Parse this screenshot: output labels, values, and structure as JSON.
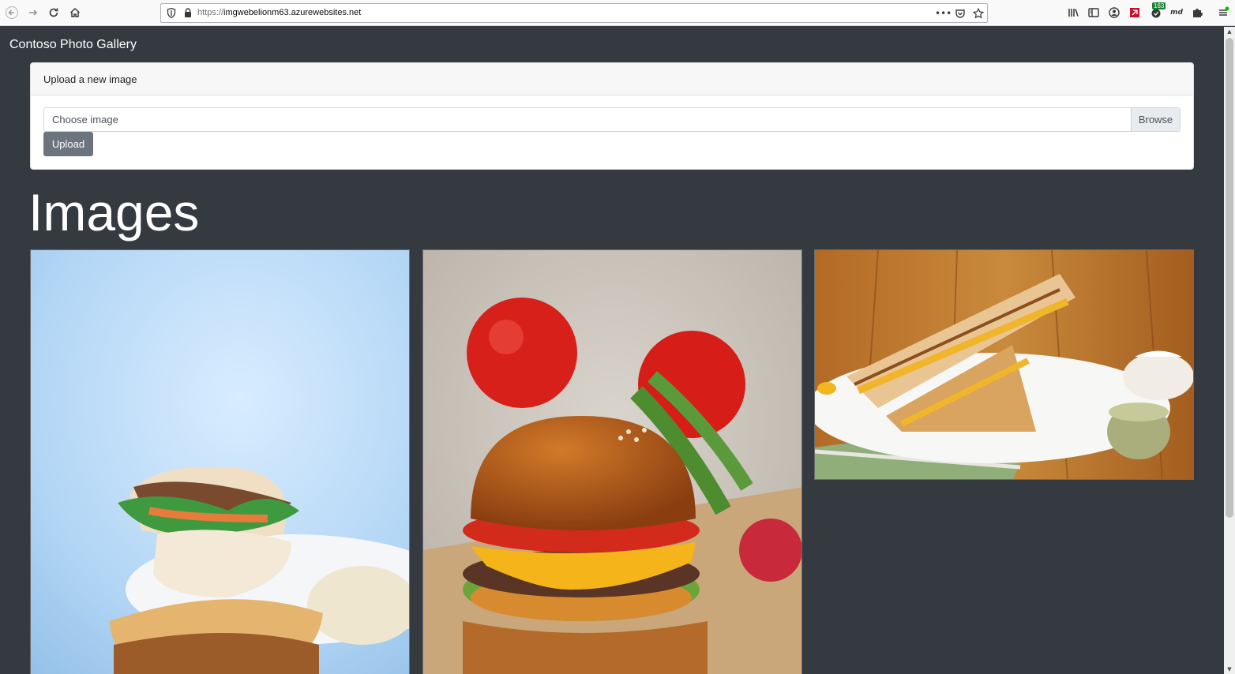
{
  "browser": {
    "url_scheme": "https://",
    "url_host": "imgwebelionm63.azurewebsites.net",
    "menu_dots": "•••",
    "extension_badge": "163",
    "ext_md_label": "md"
  },
  "navbar": {
    "brand": "Contoso Photo Gallery"
  },
  "upload_card": {
    "header": "Upload a new image",
    "file_placeholder": "Choose image",
    "browse_label": "Browse",
    "upload_label": "Upload"
  },
  "gallery": {
    "heading": "Images",
    "images": [
      {
        "icon": "sandwich-photo"
      },
      {
        "icon": "burger-photo"
      },
      {
        "icon": "grilled-sandwich-photo"
      }
    ]
  },
  "colors": {
    "page_bg": "#343a40",
    "upload_button": "#6c757d",
    "card_header_bg": "#f7f7f7"
  }
}
